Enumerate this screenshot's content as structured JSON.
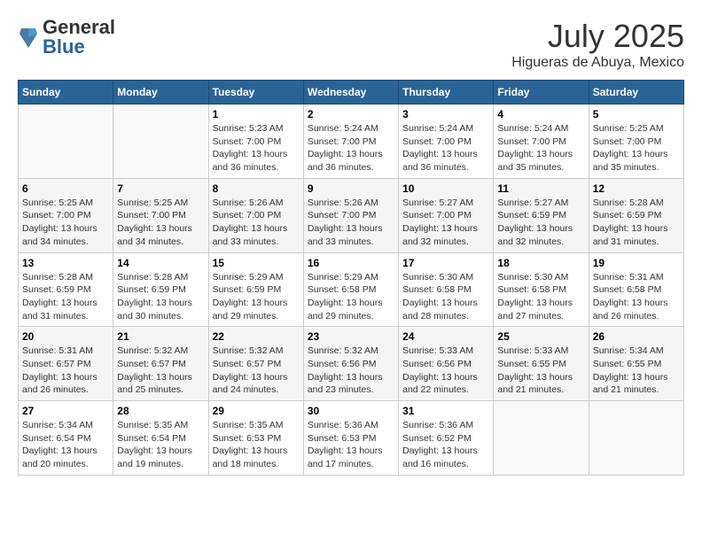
{
  "header": {
    "logo": {
      "general": "General",
      "blue": "Blue"
    },
    "title": "July 2025",
    "location": "Higueras de Abuya, Mexico"
  },
  "weekdays": [
    "Sunday",
    "Monday",
    "Tuesday",
    "Wednesday",
    "Thursday",
    "Friday",
    "Saturday"
  ],
  "weeks": [
    [
      {
        "day": "",
        "sunrise": "",
        "sunset": "",
        "daylight": ""
      },
      {
        "day": "",
        "sunrise": "",
        "sunset": "",
        "daylight": ""
      },
      {
        "day": "1",
        "sunrise": "Sunrise: 5:23 AM",
        "sunset": "Sunset: 7:00 PM",
        "daylight": "Daylight: 13 hours and 36 minutes."
      },
      {
        "day": "2",
        "sunrise": "Sunrise: 5:24 AM",
        "sunset": "Sunset: 7:00 PM",
        "daylight": "Daylight: 13 hours and 36 minutes."
      },
      {
        "day": "3",
        "sunrise": "Sunrise: 5:24 AM",
        "sunset": "Sunset: 7:00 PM",
        "daylight": "Daylight: 13 hours and 36 minutes."
      },
      {
        "day": "4",
        "sunrise": "Sunrise: 5:24 AM",
        "sunset": "Sunset: 7:00 PM",
        "daylight": "Daylight: 13 hours and 35 minutes."
      },
      {
        "day": "5",
        "sunrise": "Sunrise: 5:25 AM",
        "sunset": "Sunset: 7:00 PM",
        "daylight": "Daylight: 13 hours and 35 minutes."
      }
    ],
    [
      {
        "day": "6",
        "sunrise": "Sunrise: 5:25 AM",
        "sunset": "Sunset: 7:00 PM",
        "daylight": "Daylight: 13 hours and 34 minutes."
      },
      {
        "day": "7",
        "sunrise": "Sunrise: 5:25 AM",
        "sunset": "Sunset: 7:00 PM",
        "daylight": "Daylight: 13 hours and 34 minutes."
      },
      {
        "day": "8",
        "sunrise": "Sunrise: 5:26 AM",
        "sunset": "Sunset: 7:00 PM",
        "daylight": "Daylight: 13 hours and 33 minutes."
      },
      {
        "day": "9",
        "sunrise": "Sunrise: 5:26 AM",
        "sunset": "Sunset: 7:00 PM",
        "daylight": "Daylight: 13 hours and 33 minutes."
      },
      {
        "day": "10",
        "sunrise": "Sunrise: 5:27 AM",
        "sunset": "Sunset: 7:00 PM",
        "daylight": "Daylight: 13 hours and 32 minutes."
      },
      {
        "day": "11",
        "sunrise": "Sunrise: 5:27 AM",
        "sunset": "Sunset: 6:59 PM",
        "daylight": "Daylight: 13 hours and 32 minutes."
      },
      {
        "day": "12",
        "sunrise": "Sunrise: 5:28 AM",
        "sunset": "Sunset: 6:59 PM",
        "daylight": "Daylight: 13 hours and 31 minutes."
      }
    ],
    [
      {
        "day": "13",
        "sunrise": "Sunrise: 5:28 AM",
        "sunset": "Sunset: 6:59 PM",
        "daylight": "Daylight: 13 hours and 31 minutes."
      },
      {
        "day": "14",
        "sunrise": "Sunrise: 5:28 AM",
        "sunset": "Sunset: 6:59 PM",
        "daylight": "Daylight: 13 hours and 30 minutes."
      },
      {
        "day": "15",
        "sunrise": "Sunrise: 5:29 AM",
        "sunset": "Sunset: 6:59 PM",
        "daylight": "Daylight: 13 hours and 29 minutes."
      },
      {
        "day": "16",
        "sunrise": "Sunrise: 5:29 AM",
        "sunset": "Sunset: 6:58 PM",
        "daylight": "Daylight: 13 hours and 29 minutes."
      },
      {
        "day": "17",
        "sunrise": "Sunrise: 5:30 AM",
        "sunset": "Sunset: 6:58 PM",
        "daylight": "Daylight: 13 hours and 28 minutes."
      },
      {
        "day": "18",
        "sunrise": "Sunrise: 5:30 AM",
        "sunset": "Sunset: 6:58 PM",
        "daylight": "Daylight: 13 hours and 27 minutes."
      },
      {
        "day": "19",
        "sunrise": "Sunrise: 5:31 AM",
        "sunset": "Sunset: 6:58 PM",
        "daylight": "Daylight: 13 hours and 26 minutes."
      }
    ],
    [
      {
        "day": "20",
        "sunrise": "Sunrise: 5:31 AM",
        "sunset": "Sunset: 6:57 PM",
        "daylight": "Daylight: 13 hours and 26 minutes."
      },
      {
        "day": "21",
        "sunrise": "Sunrise: 5:32 AM",
        "sunset": "Sunset: 6:57 PM",
        "daylight": "Daylight: 13 hours and 25 minutes."
      },
      {
        "day": "22",
        "sunrise": "Sunrise: 5:32 AM",
        "sunset": "Sunset: 6:57 PM",
        "daylight": "Daylight: 13 hours and 24 minutes."
      },
      {
        "day": "23",
        "sunrise": "Sunrise: 5:32 AM",
        "sunset": "Sunset: 6:56 PM",
        "daylight": "Daylight: 13 hours and 23 minutes."
      },
      {
        "day": "24",
        "sunrise": "Sunrise: 5:33 AM",
        "sunset": "Sunset: 6:56 PM",
        "daylight": "Daylight: 13 hours and 22 minutes."
      },
      {
        "day": "25",
        "sunrise": "Sunrise: 5:33 AM",
        "sunset": "Sunset: 6:55 PM",
        "daylight": "Daylight: 13 hours and 21 minutes."
      },
      {
        "day": "26",
        "sunrise": "Sunrise: 5:34 AM",
        "sunset": "Sunset: 6:55 PM",
        "daylight": "Daylight: 13 hours and 21 minutes."
      }
    ],
    [
      {
        "day": "27",
        "sunrise": "Sunrise: 5:34 AM",
        "sunset": "Sunset: 6:54 PM",
        "daylight": "Daylight: 13 hours and 20 minutes."
      },
      {
        "day": "28",
        "sunrise": "Sunrise: 5:35 AM",
        "sunset": "Sunset: 6:54 PM",
        "daylight": "Daylight: 13 hours and 19 minutes."
      },
      {
        "day": "29",
        "sunrise": "Sunrise: 5:35 AM",
        "sunset": "Sunset: 6:53 PM",
        "daylight": "Daylight: 13 hours and 18 minutes."
      },
      {
        "day": "30",
        "sunrise": "Sunrise: 5:36 AM",
        "sunset": "Sunset: 6:53 PM",
        "daylight": "Daylight: 13 hours and 17 minutes."
      },
      {
        "day": "31",
        "sunrise": "Sunrise: 5:36 AM",
        "sunset": "Sunset: 6:52 PM",
        "daylight": "Daylight: 13 hours and 16 minutes."
      },
      {
        "day": "",
        "sunrise": "",
        "sunset": "",
        "daylight": ""
      },
      {
        "day": "",
        "sunrise": "",
        "sunset": "",
        "daylight": ""
      }
    ]
  ]
}
